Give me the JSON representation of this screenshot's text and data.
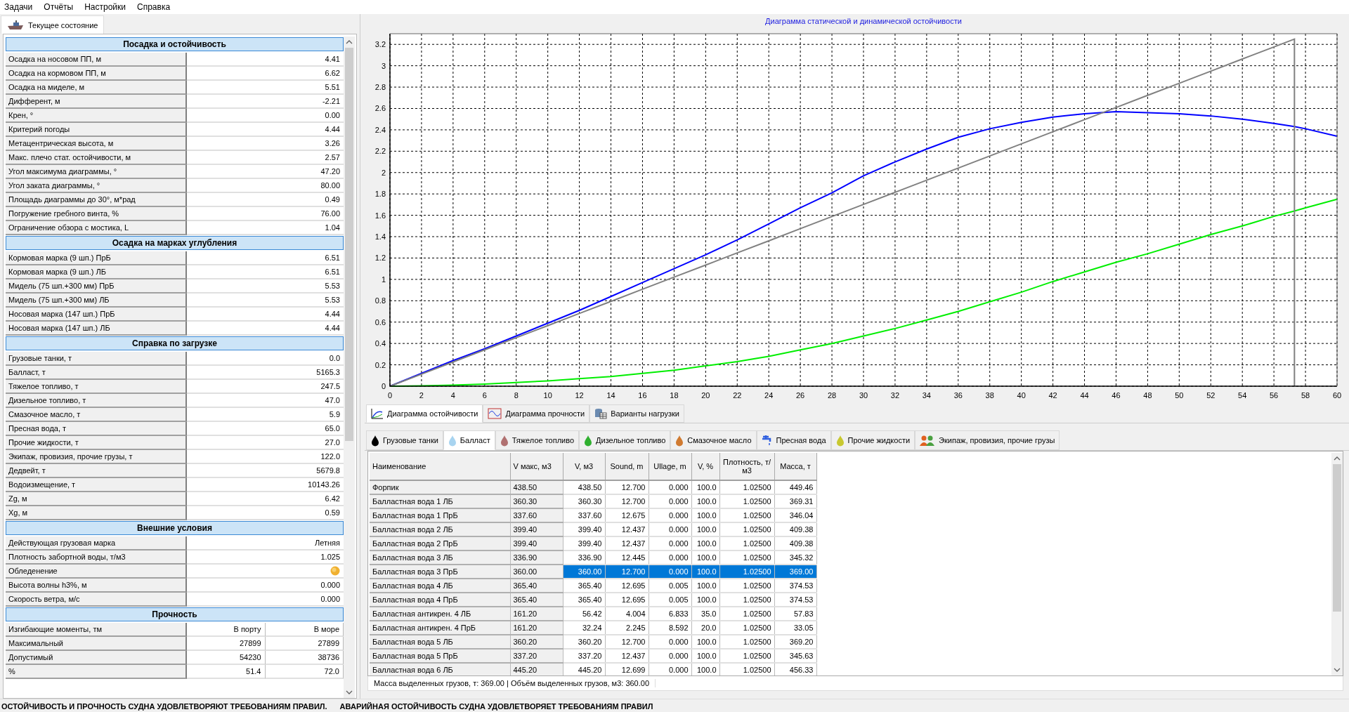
{
  "menu": [
    "Задачи",
    "Отчёты",
    "Настройки",
    "Справка"
  ],
  "left_tab": {
    "label": "Текущее состояние",
    "selected": true
  },
  "sections": [
    {
      "title": "Посадка и остойчивость",
      "kind": "pairs",
      "rows": [
        {
          "label": "Осадка на носовом ПП, м",
          "value": "4.41"
        },
        {
          "label": "Осадка на кормовом ПП, м",
          "value": "6.62"
        },
        {
          "label": "Осадка на миделе, м",
          "value": "5.51"
        },
        {
          "label": "Дифферент, м",
          "value": "-2.21"
        },
        {
          "label": "Крен, °",
          "value": "0.00"
        },
        {
          "label": "Критерий погоды",
          "value": "4.44"
        },
        {
          "label": "Метацентрическая высота, м",
          "value": "3.26"
        },
        {
          "label": "Макс. плечо стат. остойчивости, м",
          "value": "2.57"
        },
        {
          "label": "Угол максимума диаграммы, °",
          "value": "47.20"
        },
        {
          "label": "Угол заката диаграммы,  °",
          "value": "80.00"
        },
        {
          "label": "Площадь диаграммы до 30°, м*рад",
          "value": "0.49"
        },
        {
          "label": "Погружение гребного винта, %",
          "value": "76.00"
        },
        {
          "label": "Ограничение обзора с мостика, L",
          "value": "1.04"
        }
      ]
    },
    {
      "title": "Осадка на марках углубления",
      "kind": "pairs",
      "rows": [
        {
          "label": "Кормовая марка (9 шп.) ПрБ",
          "value": "6.51"
        },
        {
          "label": "Кормовая марка (9 шп.) ЛБ",
          "value": "6.51"
        },
        {
          "label": "Мидель (75 шп.+300 мм) ПрБ",
          "value": "5.53"
        },
        {
          "label": "Мидель (75 шп.+300 мм) ЛБ",
          "value": "5.53"
        },
        {
          "label": "Носовая марка (147 шп.) ПрБ",
          "value": "4.44"
        },
        {
          "label": "Носовая марка (147 шп.) ЛБ",
          "value": "4.44"
        }
      ]
    },
    {
      "title": "Справка по загрузке",
      "kind": "pairs",
      "rows": [
        {
          "label": "Грузовые танки, т",
          "value": "0.0"
        },
        {
          "label": "Балласт, т",
          "value": "5165.3"
        },
        {
          "label": "Тяжелое топливо, т",
          "value": "247.5"
        },
        {
          "label": "Дизельное топливо, т",
          "value": "47.0"
        },
        {
          "label": "Смазочное масло, т",
          "value": "5.9"
        },
        {
          "label": "Пресная вода, т",
          "value": "65.0"
        },
        {
          "label": "Прочие жидкости, т",
          "value": "27.0"
        },
        {
          "label": "Экипаж, провизия, прочие грузы, т",
          "value": "122.0"
        },
        {
          "label": "Дедвейт, т",
          "value": "5679.8"
        },
        {
          "label": "Водоизмещение, т",
          "value": "10143.26"
        },
        {
          "label": "Zg, м",
          "value": "6.42"
        },
        {
          "label": "Xg, м",
          "value": "0.59"
        }
      ]
    },
    {
      "title": "Внешние условия",
      "kind": "pairs",
      "rows": [
        {
          "label": "Действующая грузовая марка",
          "kind": "text",
          "value": "Летняя"
        },
        {
          "label": "Плотность забортной воды, т/м3",
          "kind": "text",
          "value": "1.025"
        },
        {
          "label": "Обледенение",
          "kind": "indicator"
        },
        {
          "label": "Высота волны h3%, м",
          "kind": "text",
          "value": "0.000"
        },
        {
          "label": "Скорость ветра, м/с",
          "kind": "text",
          "value": "0.000"
        }
      ]
    },
    {
      "title": "Прочность",
      "kind": "grid",
      "columns": [
        "Изгибающие моменты, тм",
        "В порту",
        "В море"
      ],
      "rows": [
        {
          "label": "Максимальный",
          "values": [
            "27899",
            "27899"
          ]
        },
        {
          "label": "Допустимый",
          "values": [
            "54230",
            "38736"
          ]
        },
        {
          "label": "%",
          "values": [
            "51.4",
            "72.0"
          ]
        }
      ]
    }
  ],
  "chart": {
    "chart_data": {
      "type": "line",
      "title": "Диаграмма статической и динамической остойчивости",
      "x": [
        0,
        2,
        4,
        6,
        8,
        10,
        12,
        14,
        16,
        18,
        20,
        22,
        24,
        26,
        28,
        30,
        32,
        34,
        36,
        38,
        40,
        42,
        44,
        46,
        48,
        50,
        52,
        54,
        56,
        57.3,
        57.3,
        58,
        60
      ],
      "xlim": [
        0,
        60
      ],
      "ylim": [
        0,
        3.3
      ],
      "grid": true,
      "xticks": [
        0,
        2,
        4,
        6,
        8,
        10,
        12,
        14,
        16,
        18,
        20,
        22,
        24,
        26,
        28,
        30,
        32,
        34,
        36,
        38,
        40,
        42,
        44,
        46,
        48,
        50,
        52,
        54,
        56,
        58,
        60
      ],
      "yticks": [
        0,
        0.2,
        0.4,
        0.6,
        0.8,
        1,
        1.2,
        1.4,
        1.6,
        1.8,
        2,
        2.2,
        2.4,
        2.6,
        2.8,
        3,
        3.2
      ],
      "series": [
        {
          "color": "#0000ff",
          "values": [
            0,
            0.12,
            0.24,
            0.35,
            0.47,
            0.59,
            0.71,
            0.84,
            0.97,
            1.1,
            1.23,
            1.37,
            1.52,
            1.67,
            1.81,
            1.97,
            2.1,
            2.22,
            2.33,
            2.41,
            2.47,
            2.52,
            2.55,
            2.57,
            2.56,
            2.55,
            2.53,
            2.5,
            2.46,
            2.43,
            2.43,
            2.41,
            2.34
          ]
        },
        {
          "color": "#00ee00",
          "values": [
            0,
            0.003,
            0.01,
            0.02,
            0.035,
            0.05,
            0.07,
            0.09,
            0.12,
            0.15,
            0.19,
            0.23,
            0.28,
            0.34,
            0.4,
            0.47,
            0.54,
            0.62,
            0.7,
            0.79,
            0.88,
            0.98,
            1.07,
            1.16,
            1.24,
            1.33,
            1.42,
            1.5,
            1.59,
            1.64,
            1.64,
            1.67,
            1.75
          ]
        },
        {
          "color": "#808080",
          "values": [
            0,
            0.113,
            0.227,
            0.34,
            0.454,
            0.567,
            0.681,
            0.794,
            0.908,
            1.021,
            1.134,
            1.248,
            1.361,
            1.475,
            1.588,
            1.702,
            1.815,
            1.929,
            2.042,
            2.155,
            2.269,
            2.382,
            2.496,
            2.609,
            2.723,
            2.836,
            2.949,
            3.063,
            3.176,
            3.25,
            0,
            null,
            null
          ]
        }
      ]
    }
  },
  "chart_tabs": [
    {
      "label": "Диаграмма остойчивости",
      "selected": true,
      "kind": "stability"
    },
    {
      "label": "Диаграмма прочности",
      "selected": false,
      "kind": "strength"
    },
    {
      "label": "Варианты нагрузки",
      "selected": false,
      "kind": "variants"
    }
  ],
  "fuel_tabs": [
    {
      "label": "Грузовые танки",
      "selected": false,
      "kind": "drop",
      "color": "#000000"
    },
    {
      "label": "Балласт",
      "selected": true,
      "kind": "drop",
      "color": "#a8d4f0"
    },
    {
      "label": "Тяжелое топливо",
      "selected": false,
      "kind": "drop",
      "color": "#b07070"
    },
    {
      "label": "Дизельное топливо",
      "selected": false,
      "kind": "drop",
      "color": "#30b030"
    },
    {
      "label": "Смазочное масло",
      "selected": false,
      "kind": "drop",
      "color": "#d07a30"
    },
    {
      "label": "Пресная вода",
      "selected": false,
      "kind": "tap",
      "color": "#3060e0"
    },
    {
      "label": "Прочие жидкости",
      "selected": false,
      "kind": "drop",
      "color": "#c8c830"
    },
    {
      "label": "Экипаж, провизия, прочие грузы",
      "selected": false,
      "kind": "people",
      "color": "#e06020"
    }
  ],
  "table": {
    "columns": [
      "Наименование",
      "V макс, м3",
      "V, м3",
      "Sound, m",
      "Ullage, m",
      "V, %",
      "Плотность, т/м3",
      "Масса, т"
    ],
    "rows": [
      {
        "selected": false,
        "cells": [
          "Форпик",
          "438.50",
          "438.50",
          "12.700",
          "0.000",
          "100.0",
          "1.02500",
          "449.46"
        ]
      },
      {
        "selected": false,
        "cells": [
          "Балластная вода 1 ЛБ",
          "360.30",
          "360.30",
          "12.700",
          "0.000",
          "100.0",
          "1.02500",
          "369.31"
        ]
      },
      {
        "selected": false,
        "cells": [
          "Балластная вода 1 ПрБ",
          "337.60",
          "337.60",
          "12.675",
          "0.000",
          "100.0",
          "1.02500",
          "346.04"
        ]
      },
      {
        "selected": false,
        "cells": [
          "Балластная вода 2 ЛБ",
          "399.40",
          "399.40",
          "12.437",
          "0.000",
          "100.0",
          "1.02500",
          "409.38"
        ]
      },
      {
        "selected": false,
        "cells": [
          "Балластная вода 2 ПрБ",
          "399.40",
          "399.40",
          "12.437",
          "0.000",
          "100.0",
          "1.02500",
          "409.38"
        ]
      },
      {
        "selected": false,
        "cells": [
          "Балластная вода 3 ЛБ",
          "336.90",
          "336.90",
          "12.445",
          "0.000",
          "100.0",
          "1.02500",
          "345.32"
        ]
      },
      {
        "selected": true,
        "cells": [
          "Балластная вода 3 ПрБ",
          "360.00",
          "360.00",
          "12.700",
          "0.000",
          "100.0",
          "1.02500",
          "369.00"
        ]
      },
      {
        "selected": false,
        "cells": [
          "Балластная вода 4 ЛБ",
          "365.40",
          "365.40",
          "12.695",
          "0.005",
          "100.0",
          "1.02500",
          "374.53"
        ]
      },
      {
        "selected": false,
        "cells": [
          "Балластная вода 4 ПрБ",
          "365.40",
          "365.40",
          "12.695",
          "0.005",
          "100.0",
          "1.02500",
          "374.53"
        ]
      },
      {
        "selected": false,
        "cells": [
          "Балластная антикрен. 4 ЛБ",
          "161.20",
          "56.42",
          "4.004",
          "6.833",
          "35.0",
          "1.02500",
          "57.83"
        ]
      },
      {
        "selected": false,
        "cells": [
          "Балластная антикрен. 4 ПрБ",
          "161.20",
          "32.24",
          "2.245",
          "8.592",
          "20.0",
          "1.02500",
          "33.05"
        ]
      },
      {
        "selected": false,
        "cells": [
          "Балластная вода 5 ЛБ",
          "360.20",
          "360.20",
          "12.700",
          "0.000",
          "100.0",
          "1.02500",
          "369.20"
        ]
      },
      {
        "selected": false,
        "cells": [
          "Балластная вода 5 ПрБ",
          "337.20",
          "337.20",
          "12.437",
          "0.000",
          "100.0",
          "1.02500",
          "345.63"
        ]
      },
      {
        "selected": false,
        "cells": [
          "Балластная вода 6 ЛБ",
          "445.20",
          "445.20",
          "12.699",
          "0.000",
          "100.0",
          "1.02500",
          "456.33"
        ]
      }
    ]
  },
  "summary": "Масса выделенных грузов, т: 369.00 | Объём выделенных грузов, м3: 360.00",
  "status": [
    "ОСТОЙЧИВОСТЬ И ПРОЧНОСТЬ СУДНА УДОВЛЕТВОРЯЮТ ТРЕБОВАНИЯМ ПРАВИЛ.",
    "АВАРИЙНАЯ ОСТОЙЧИВОСТЬ СУДНА УДОВЛЕТВОРЯЕТ ТРЕБОВАНИЯМ ПРАВИЛ"
  ]
}
